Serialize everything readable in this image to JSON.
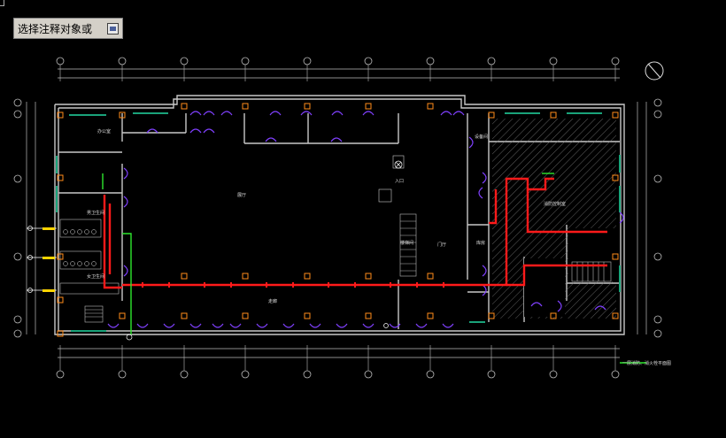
{
  "command_prompt": {
    "text": "选择注释对象或"
  },
  "drawing": {
    "grid_columns": [
      "①",
      "②",
      "③",
      "④",
      "⑤",
      "⑥",
      "⑦",
      "⑧",
      "⑨",
      "⑩",
      "⑪"
    ],
    "grid_rows": [
      "Ⓐ",
      "Ⓑ",
      "Ⓒ",
      "Ⓓ",
      "Ⓔ",
      "Ⓕ"
    ],
    "room_labels": {
      "hall": "展厅",
      "office": "办公室",
      "lobby": "门厅",
      "corridor": "走廊",
      "stair": "楼梯间",
      "fire_room": "消防控制室",
      "storage": "库房",
      "toilet_m": "男卫生间",
      "toilet_f": "女卫生间",
      "equip": "设备间",
      "entrance": "入口"
    },
    "legend_text": "一层消防、消火栓平面图",
    "colors": {
      "walls": "#c8c8c8",
      "sprinkler_main": "#ff1a1a",
      "hydrant_pipe": "#2ee82e",
      "doors": "#8040ff",
      "columns": "#ff8c1a",
      "windows": "#1aa37a"
    },
    "icons": [
      "north-arrow-icon",
      "hydrant-icon",
      "fire-alarm-icon"
    ]
  }
}
